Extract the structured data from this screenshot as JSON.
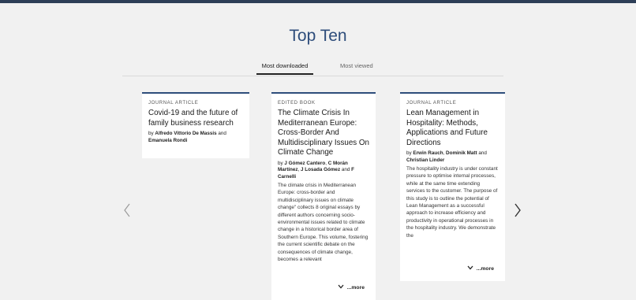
{
  "section_title": "Top Ten",
  "tabs": [
    {
      "label": "Most downloaded",
      "active": true
    },
    {
      "label": "Most viewed",
      "active": false
    }
  ],
  "cards": [
    {
      "type": "Journal Article",
      "title": "Covid-19 and the future of family business research",
      "by": "by",
      "authors": [
        "Alfredo Vittorio De Massis",
        "Emanuela Rondi"
      ],
      "and": "and",
      "abstract": ""
    },
    {
      "type": "Edited Book",
      "title": "The Climate Crisis In Mediterranean Europe: Cross-Border And Multidisciplinary Issues On Climate Change",
      "by": "by",
      "authors": [
        "J Gómez Cantero",
        "C Morán Martínez",
        "J Losada Gómez",
        "F Carnelli"
      ],
      "and": "and",
      "abstract": "The climate crisis in Mediterranean Europe: cross-border and multidisciplinary issues on climate change\" collects 8 original essays by different authors concerning socio-environmental issues related to climate change in a historical border area of Southern Europe. This volume, fostering the current scientific debate on the consequences of climate change, becomes a relevant",
      "more_label": "...more"
    },
    {
      "type": "Journal Article",
      "title": "Lean Management in Hospitality: Methods, Applications and Future Directions",
      "by": "by",
      "authors": [
        "Erwin Rauch",
        "Dominik Matt",
        "Christian Linder"
      ],
      "and": "and",
      "abstract": "The hospitality industry is under constant pressure to optimise internal processes, while at the same time extending services to the customer. The purpose of this study is to outline the potential of Lean Management as a successful approach to increase efficiency and productivity in operational processes in the hospitality industry. We demonstrate the",
      "more_label": "...more"
    }
  ],
  "icons": {
    "prev": "chevron-left-icon",
    "next": "chevron-right-icon",
    "expand": "chevron-down-icon"
  },
  "colors": {
    "accent": "#2e4d7b",
    "topbar": "#2d3e57",
    "background": "#f1f1f1"
  }
}
